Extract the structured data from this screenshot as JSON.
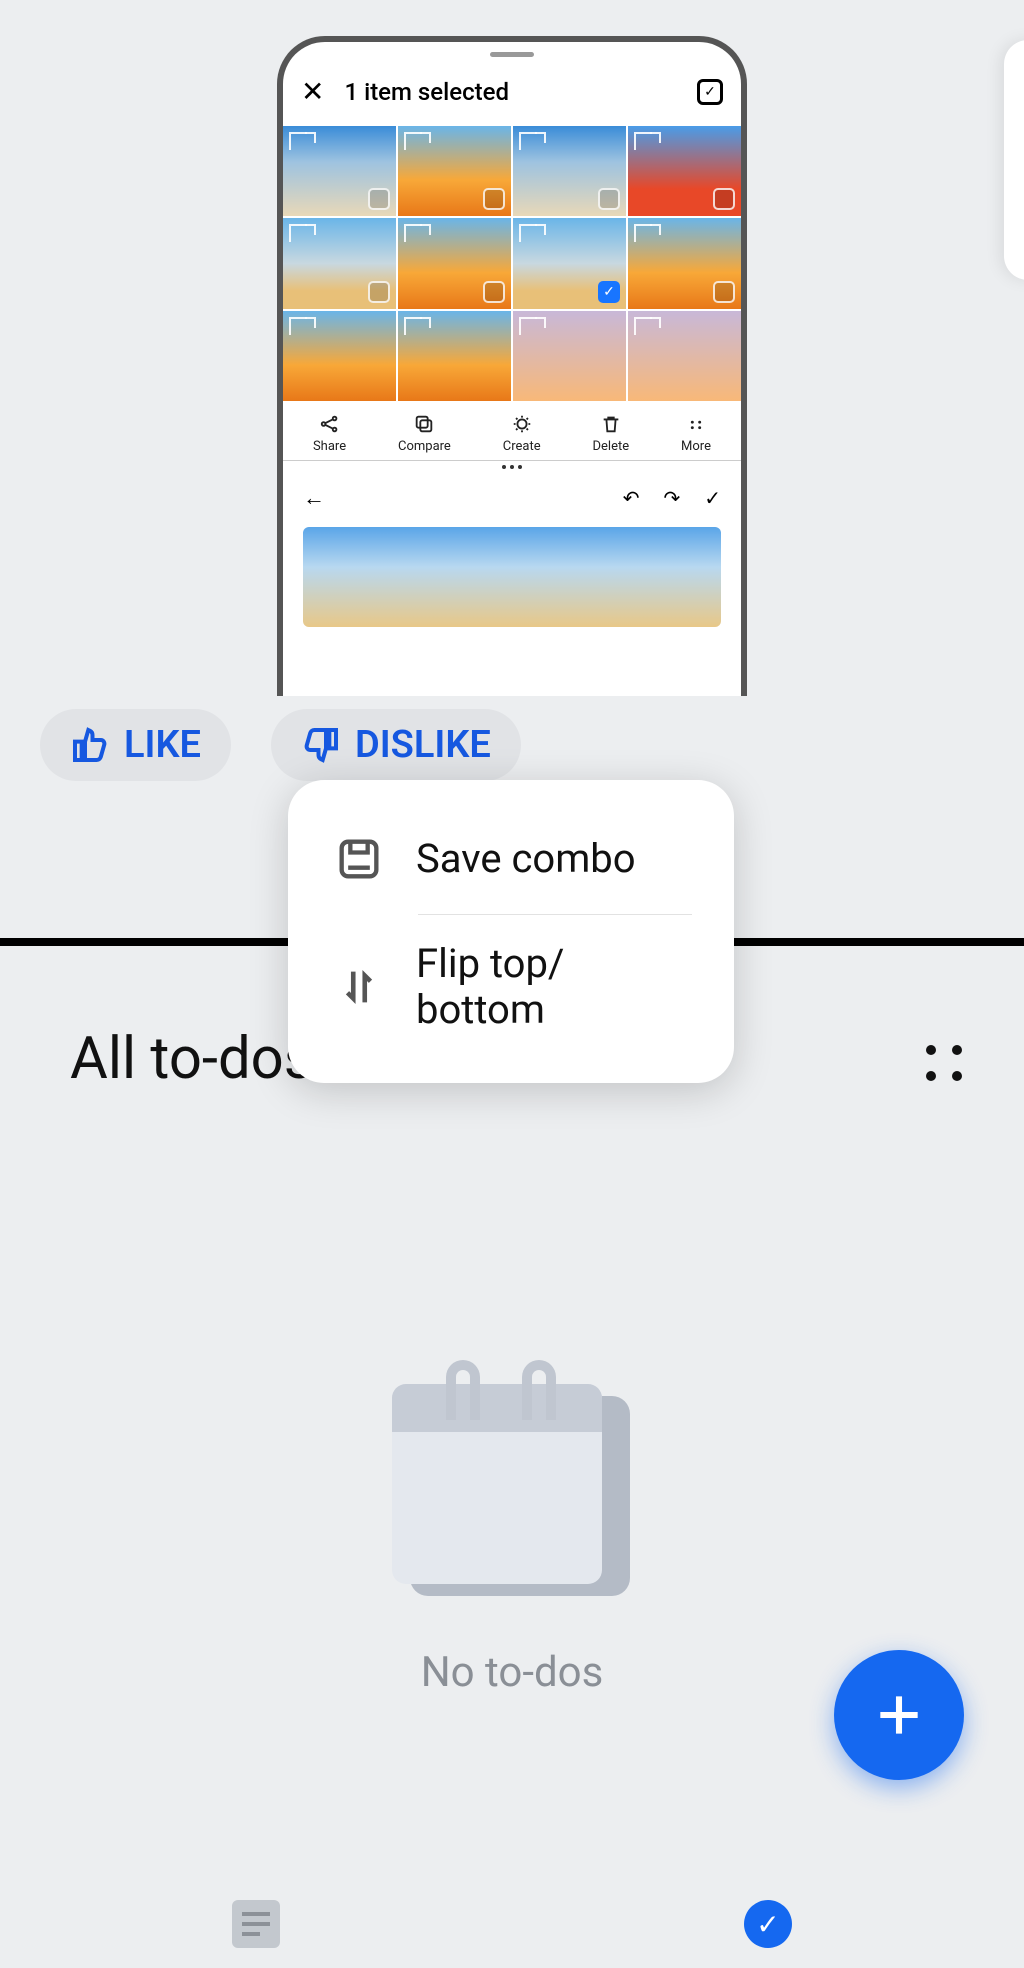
{
  "phone": {
    "header_title": "1 item selected",
    "toolbar": {
      "share": "Share",
      "compare": "Compare",
      "create": "Create",
      "delete": "Delete",
      "more": "More"
    }
  },
  "feedback": {
    "like_label": "LIKE",
    "dislike_label": "DISLIKE"
  },
  "context_menu": {
    "save_combo": "Save combo",
    "flip": "Flip top/\nbottom"
  },
  "todo": {
    "header": "All to-dos",
    "empty_text": "No to-dos"
  }
}
